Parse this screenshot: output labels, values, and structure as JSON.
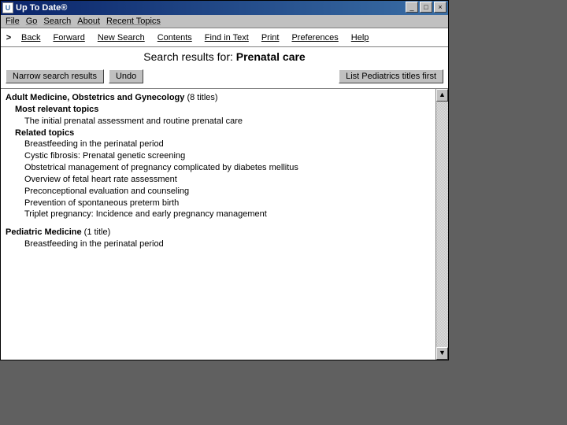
{
  "window": {
    "title": "Up To Date®",
    "controls": {
      "minimize": "_",
      "maximize": "□",
      "close": "×"
    }
  },
  "menubar": [
    "File",
    "Go",
    "Search",
    "About",
    "Recent Topics"
  ],
  "toolbar": {
    "arrow": ">",
    "items": [
      "Back",
      "Forward",
      "New Search",
      "Contents",
      "Find in Text",
      "Print",
      "Preferences",
      "Help"
    ]
  },
  "search": {
    "label": "Search results for: ",
    "query": "Prenatal care"
  },
  "actions": {
    "narrow": "Narrow search results",
    "undo": "Undo",
    "listfirst": "List Pediatrics titles first"
  },
  "sections": [
    {
      "title": "Adult Medicine, Obstetrics and Gynecology",
      "count": "(8 titles)",
      "groups": [
        {
          "header": "Most relevant topics",
          "topics": [
            "The initial prenatal assessment and routine prenatal care"
          ]
        },
        {
          "header": "Related topics",
          "topics": [
            "Breastfeeding in the perinatal period",
            "Cystic fibrosis: Prenatal genetic screening",
            "Obstetrical management of pregnancy complicated by diabetes mellitus",
            "Overview of fetal heart rate assessment",
            "Preconceptional evaluation and counseling",
            "Prevention of spontaneous preterm birth",
            "Triplet pregnancy: Incidence and early pregnancy management"
          ]
        }
      ]
    },
    {
      "title": "Pediatric Medicine",
      "count": "(1 title)",
      "groups": [
        {
          "header": null,
          "topics": [
            "Breastfeeding in the perinatal period"
          ]
        }
      ]
    }
  ]
}
